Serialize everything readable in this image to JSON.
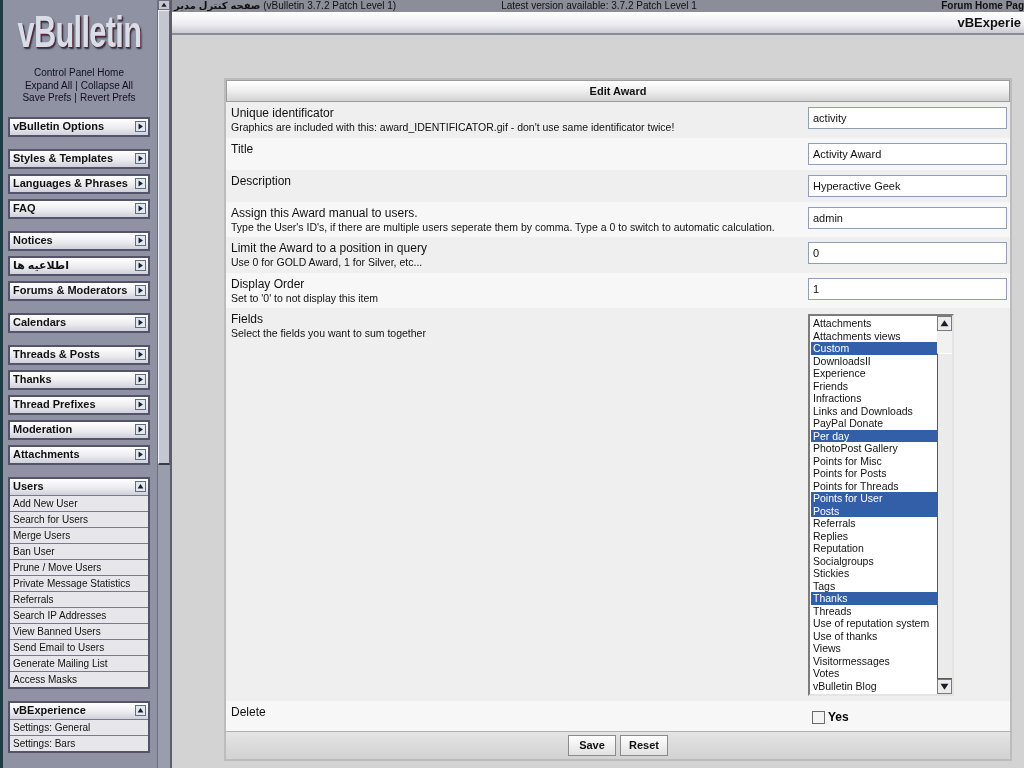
{
  "top_bar": {
    "title": "**صفحه کنترل مدیر** (vBulletin 3.7.2 Patch Level 1)",
    "version_notice": "Latest version available: 3.7.2 Patch Level 1",
    "forum_link": "Forum Home Pag"
  },
  "header": {
    "title": "vBExperie"
  },
  "sidebar": {
    "logo": "vBulletin",
    "links": [
      {
        "links": [
          "Control Panel Home"
        ]
      },
      {
        "links": [
          "Expand All",
          "Collapse All"
        ],
        "separator": "|"
      },
      {
        "links": [
          "Save Prefs",
          "Revert Prefs"
        ],
        "separator": "|"
      }
    ],
    "clusters": [
      [
        {
          "title": "vBulletin Options",
          "expanded": false
        }
      ],
      [
        {
          "title": "Styles & Templates",
          "expanded": false
        },
        {
          "title": "Languages & Phrases",
          "expanded": false
        },
        {
          "title": "FAQ",
          "expanded": false
        }
      ],
      [
        {
          "title": "Notices",
          "expanded": false
        },
        {
          "title": "اطلاعیه ها",
          "expanded": false
        },
        {
          "title": "Forums & Moderators",
          "expanded": false
        }
      ],
      [
        {
          "title": "Calendars",
          "expanded": false
        }
      ],
      [
        {
          "title": "Threads & Posts",
          "expanded": false
        },
        {
          "title": "Thanks",
          "expanded": false
        },
        {
          "title": "Thread Prefixes",
          "expanded": false
        },
        {
          "title": "Moderation",
          "expanded": false
        },
        {
          "title": "Attachments",
          "expanded": false
        }
      ],
      [
        {
          "title": "Users",
          "expanded": true,
          "items": [
            "Add New User",
            "Search for Users",
            "Merge Users",
            "Ban User",
            "Prune / Move Users",
            "Private Message Statistics",
            "Referrals",
            "Search IP Addresses",
            "View Banned Users",
            "Send Email to Users",
            "Generate Mailing List",
            "Access Masks"
          ]
        }
      ],
      [
        {
          "title": "vBExperience",
          "expanded": true,
          "items": [
            "Settings: General",
            "Settings: Bars"
          ]
        }
      ]
    ]
  },
  "form": {
    "title": "Edit Award",
    "rows": [
      {
        "kind": "text",
        "label": "Unique identificator",
        "description": "Graphics are included with this: award_IDENTIFICATOR.gif - don't use same identificator twice!",
        "value": "activity"
      },
      {
        "kind": "text",
        "label": "Title",
        "value": "Activity Award"
      },
      {
        "kind": "text",
        "label": "Description",
        "value": "Hyperactive Geek"
      },
      {
        "kind": "text",
        "label": "Assign this Award manual to users.",
        "description": "Type the User's ID's, if there are multiple users seperate them by comma. Type a 0 to switch to automatic calculation.",
        "value": "admin"
      },
      {
        "kind": "text",
        "label": "Limit the Award to a position in query",
        "description": "Use 0 for GOLD Award, 1 for Silver, etc...",
        "value": "0"
      },
      {
        "kind": "text",
        "label": "Display Order",
        "description": "Set to '0' to not display this item",
        "value": "1"
      },
      {
        "kind": "listbox",
        "label": "Fields",
        "description": "Select the fields you want to sum together",
        "options": [
          {
            "text": "Attachments",
            "selected": false
          },
          {
            "text": "Attachments views",
            "selected": false
          },
          {
            "text": "Custom",
            "selected": true
          },
          {
            "text": "DownloadsII",
            "selected": false
          },
          {
            "text": "Experience",
            "selected": false
          },
          {
            "text": "Friends",
            "selected": false
          },
          {
            "text": "Infractions",
            "selected": false
          },
          {
            "text": "Links and Downloads",
            "selected": false
          },
          {
            "text": "PayPal Donate",
            "selected": false
          },
          {
            "text": "Per day",
            "selected": true
          },
          {
            "text": "PhotoPost Gallery",
            "selected": false
          },
          {
            "text": "Points for Misc",
            "selected": false
          },
          {
            "text": "Points for Posts",
            "selected": false
          },
          {
            "text": "Points for Threads",
            "selected": false
          },
          {
            "text": "Points for User",
            "selected": true
          },
          {
            "text": "Posts",
            "selected": true
          },
          {
            "text": "Referrals",
            "selected": false
          },
          {
            "text": "Replies",
            "selected": false
          },
          {
            "text": "Reputation",
            "selected": false
          },
          {
            "text": "Socialgroups",
            "selected": false
          },
          {
            "text": "Stickies",
            "selected": false
          },
          {
            "text": "Tags",
            "selected": false
          },
          {
            "text": "Thanks",
            "selected": true
          },
          {
            "text": "Threads",
            "selected": false
          },
          {
            "text": "Use of reputation system",
            "selected": false
          },
          {
            "text": "Use of thanks",
            "selected": false
          },
          {
            "text": "Views",
            "selected": false
          },
          {
            "text": "Visitormessages",
            "selected": false
          },
          {
            "text": "Votes",
            "selected": false
          },
          {
            "text": "vBulletin Blog",
            "selected": false
          }
        ]
      },
      {
        "kind": "checkbox",
        "label": "Delete",
        "option": "Yes",
        "checked": false
      }
    ],
    "buttons": [
      "Save",
      "Reset"
    ]
  }
}
